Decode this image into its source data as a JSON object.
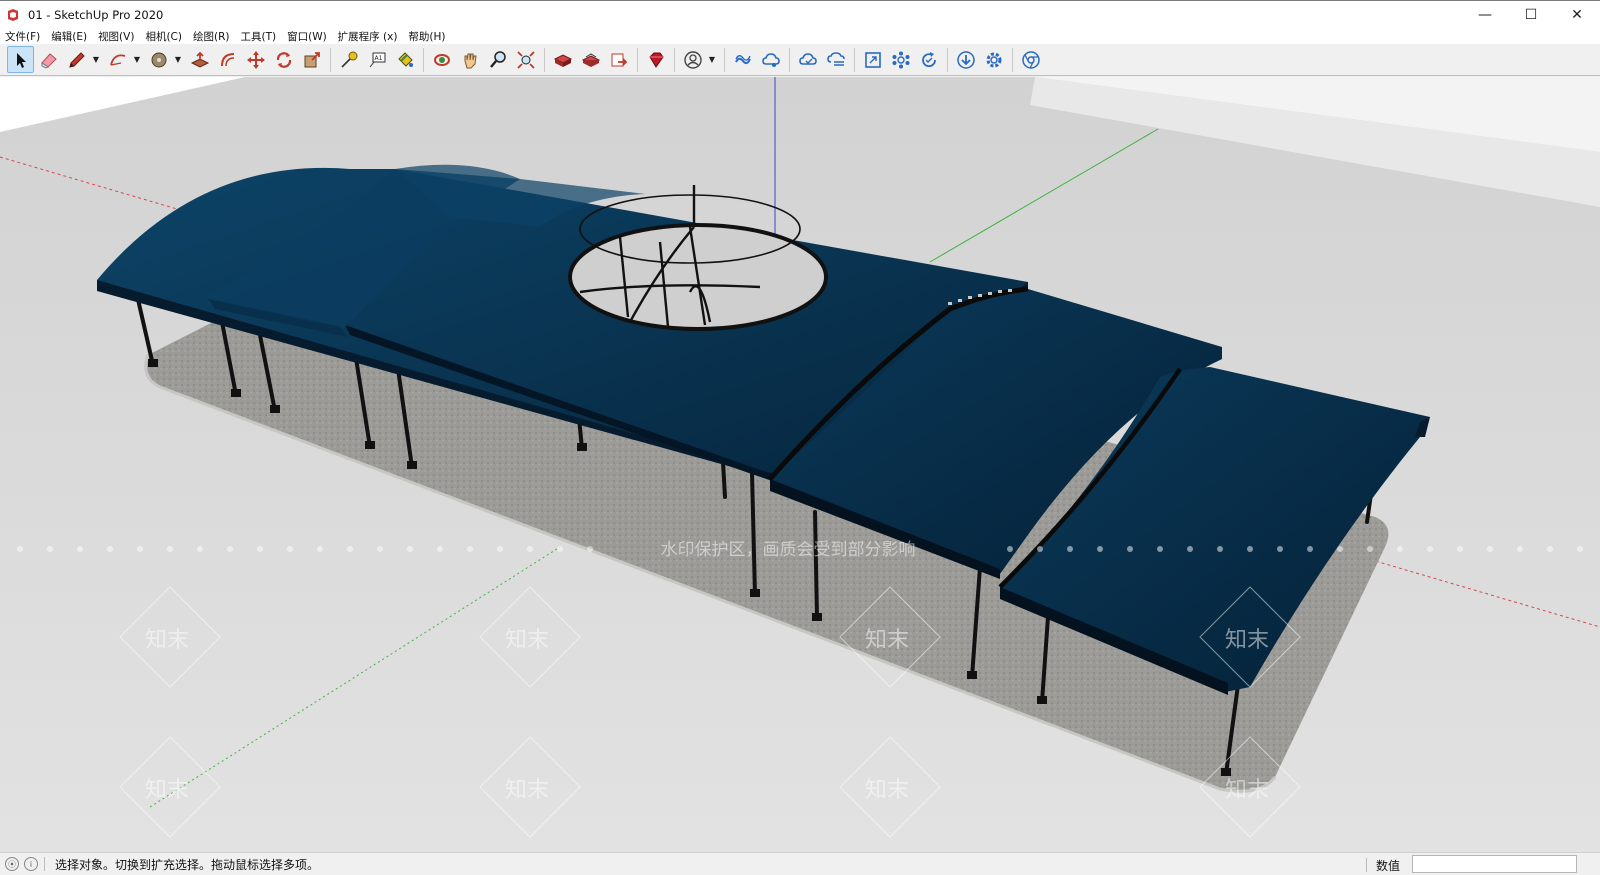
{
  "window": {
    "title": "01 - SketchUp Pro 2020",
    "controls": {
      "minimize": "—",
      "maximize": "☐",
      "close": "✕"
    }
  },
  "menu": {
    "items": [
      "文件(F)",
      "编辑(E)",
      "视图(V)",
      "相机(C)",
      "绘图(R)",
      "工具(T)",
      "窗口(W)",
      "扩展程序 (x)",
      "帮助(H)"
    ]
  },
  "toolbar": {
    "tools": [
      {
        "name": "select-icon"
      },
      {
        "name": "eraser-icon"
      },
      {
        "name": "pencil-icon"
      },
      {
        "name": "arc-icon"
      },
      {
        "name": "shape-icon"
      },
      {
        "name": "push-pull-icon"
      },
      {
        "name": "offset-icon"
      },
      {
        "name": "move-icon"
      },
      {
        "name": "rotate-icon"
      },
      {
        "name": "scale-icon"
      },
      {
        "name": "tape-measure-icon"
      },
      {
        "name": "text-icon"
      },
      {
        "name": "paint-bucket-icon"
      },
      {
        "name": "orbit-icon"
      },
      {
        "name": "pan-icon"
      },
      {
        "name": "zoom-icon"
      },
      {
        "name": "zoom-extents-icon"
      },
      {
        "name": "warehouse-icon"
      },
      {
        "name": "extension-warehouse-icon"
      },
      {
        "name": "layout-icon"
      },
      {
        "name": "ruby-icon"
      },
      {
        "name": "account-icon"
      },
      {
        "name": "trimble-connect-icon"
      },
      {
        "name": "cloud-share-icon"
      },
      {
        "name": "cloud-sync-icon"
      },
      {
        "name": "cloud-list-icon"
      },
      {
        "name": "zoom-window-icon"
      },
      {
        "name": "components-icon"
      },
      {
        "name": "refresh-icon"
      },
      {
        "name": "download-icon"
      },
      {
        "name": "settings-icon"
      },
      {
        "name": "chrome-icon"
      }
    ]
  },
  "viewport": {
    "watermark_text": "水印保护区，画质会受到部分影响",
    "watermark_brand": "知末",
    "colors": {
      "roof": "#0b3a5c",
      "roof_dark": "#062238",
      "ground": "#dcdcdc",
      "sky": "#ffffff",
      "platform": "#9a9a96",
      "axis_red": "#d24a4a",
      "axis_green": "#3fb43f",
      "axis_blue": "#5a5ad2"
    }
  },
  "status": {
    "message": "选择对象。切换到扩充选择。拖动鼠标选择多项。",
    "measure_label": "数值",
    "measure_value": ""
  }
}
